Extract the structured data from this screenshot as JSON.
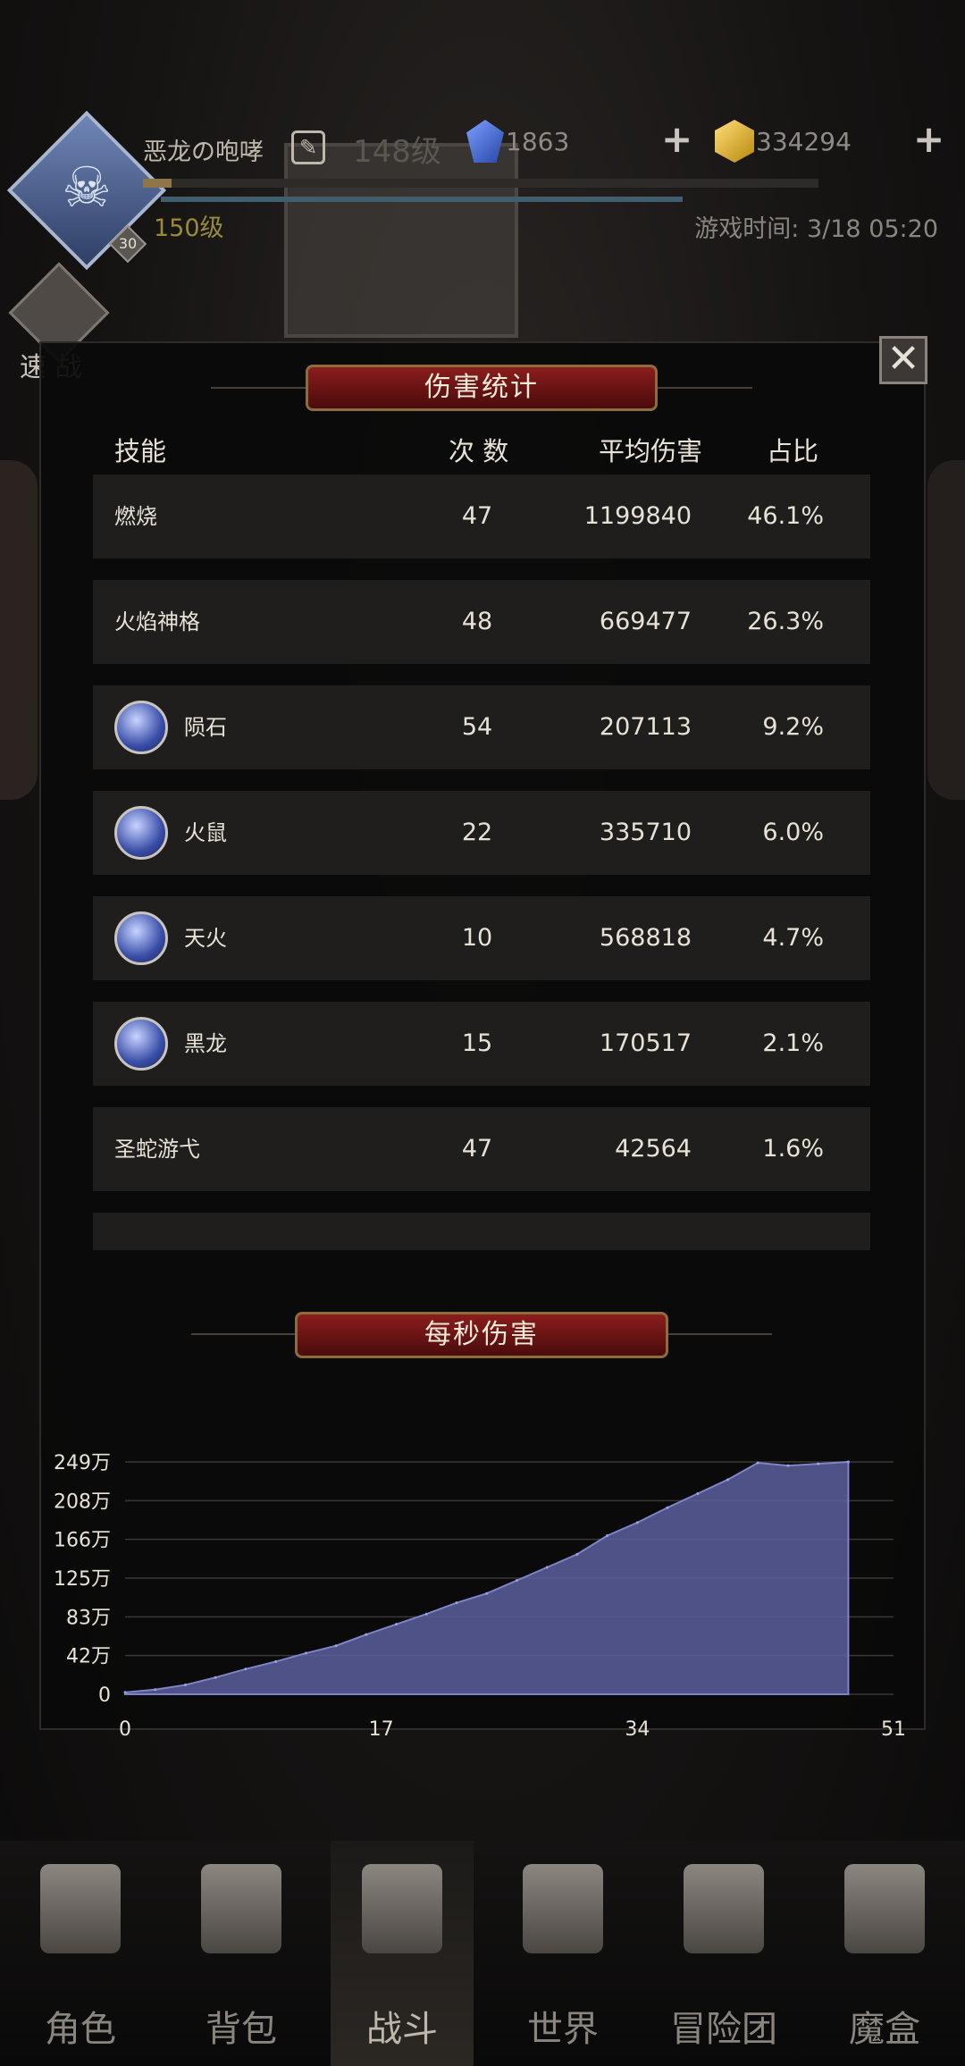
{
  "top_bar": {
    "player_name": "恶龙の咆哮",
    "faded_level": "148级",
    "gems": "1863",
    "gold": "334294",
    "level": "150级",
    "avatar_badge": "30",
    "game_time": "游戏时间: 3/18 05:20",
    "speed_battle": "速 战",
    "plus_symbol": "+"
  },
  "damage_panel": {
    "title": "伤害统计",
    "close_symbol": "✕",
    "columns": [
      "技能",
      "次 数",
      "平均伤害",
      "占比"
    ],
    "rows": [
      {
        "skill": "燃烧",
        "count": "47",
        "avg": "1199840",
        "pct": "46.1%",
        "icon": ""
      },
      {
        "skill": "火焰神格",
        "count": "48",
        "avg": "669477",
        "pct": "26.3%",
        "icon": ""
      },
      {
        "skill": "陨石",
        "count": "54",
        "avg": "207113",
        "pct": "9.2%",
        "icon": "meteor-icon"
      },
      {
        "skill": "火鼠",
        "count": "22",
        "avg": "335710",
        "pct": "6.0%",
        "icon": "fire-rat-icon"
      },
      {
        "skill": "天火",
        "count": "10",
        "avg": "568818",
        "pct": "4.7%",
        "icon": "sky-fire-icon"
      },
      {
        "skill": "黑龙",
        "count": "15",
        "avg": "170517",
        "pct": "2.1%",
        "icon": "black-dragon-icon"
      },
      {
        "skill": "圣蛇游弋",
        "count": "47",
        "avg": "42564",
        "pct": "1.6%",
        "icon": ""
      }
    ]
  },
  "dps_panel": {
    "title": "每秒伤害"
  },
  "chart_data": {
    "type": "area",
    "title": "每秒伤害",
    "x": [
      0,
      2,
      4,
      6,
      8,
      10,
      12,
      14,
      16,
      18,
      20,
      22,
      24,
      26,
      28,
      30,
      32,
      34,
      36,
      38,
      40,
      42,
      44,
      46,
      48
    ],
    "values": [
      2,
      5,
      10,
      18,
      27,
      35,
      44,
      52,
      64,
      75,
      86,
      98,
      108,
      122,
      136,
      150,
      170,
      184,
      200,
      215,
      230,
      248,
      245,
      247,
      249
    ],
    "xticks": [
      "0",
      "17",
      "34",
      "51"
    ],
    "xlim": [
      0,
      51
    ],
    "yticks": [
      "0",
      "42万",
      "83万",
      "125万",
      "166万",
      "208万",
      "249万"
    ],
    "ylim": [
      0,
      249
    ],
    "grid": true,
    "color": "#5b5f9e"
  },
  "nav": {
    "items": [
      {
        "label": "角色",
        "icon": "character-helmet-icon"
      },
      {
        "label": "背包",
        "icon": "backpack-icon"
      },
      {
        "label": "战斗",
        "icon": "battle-shield-icon"
      },
      {
        "label": "世界",
        "icon": "world-map-icon"
      },
      {
        "label": "冒险团",
        "icon": "adventure-castle-icon"
      },
      {
        "label": "魔盒",
        "icon": "magic-box-icon"
      }
    ],
    "active_index": 2
  }
}
